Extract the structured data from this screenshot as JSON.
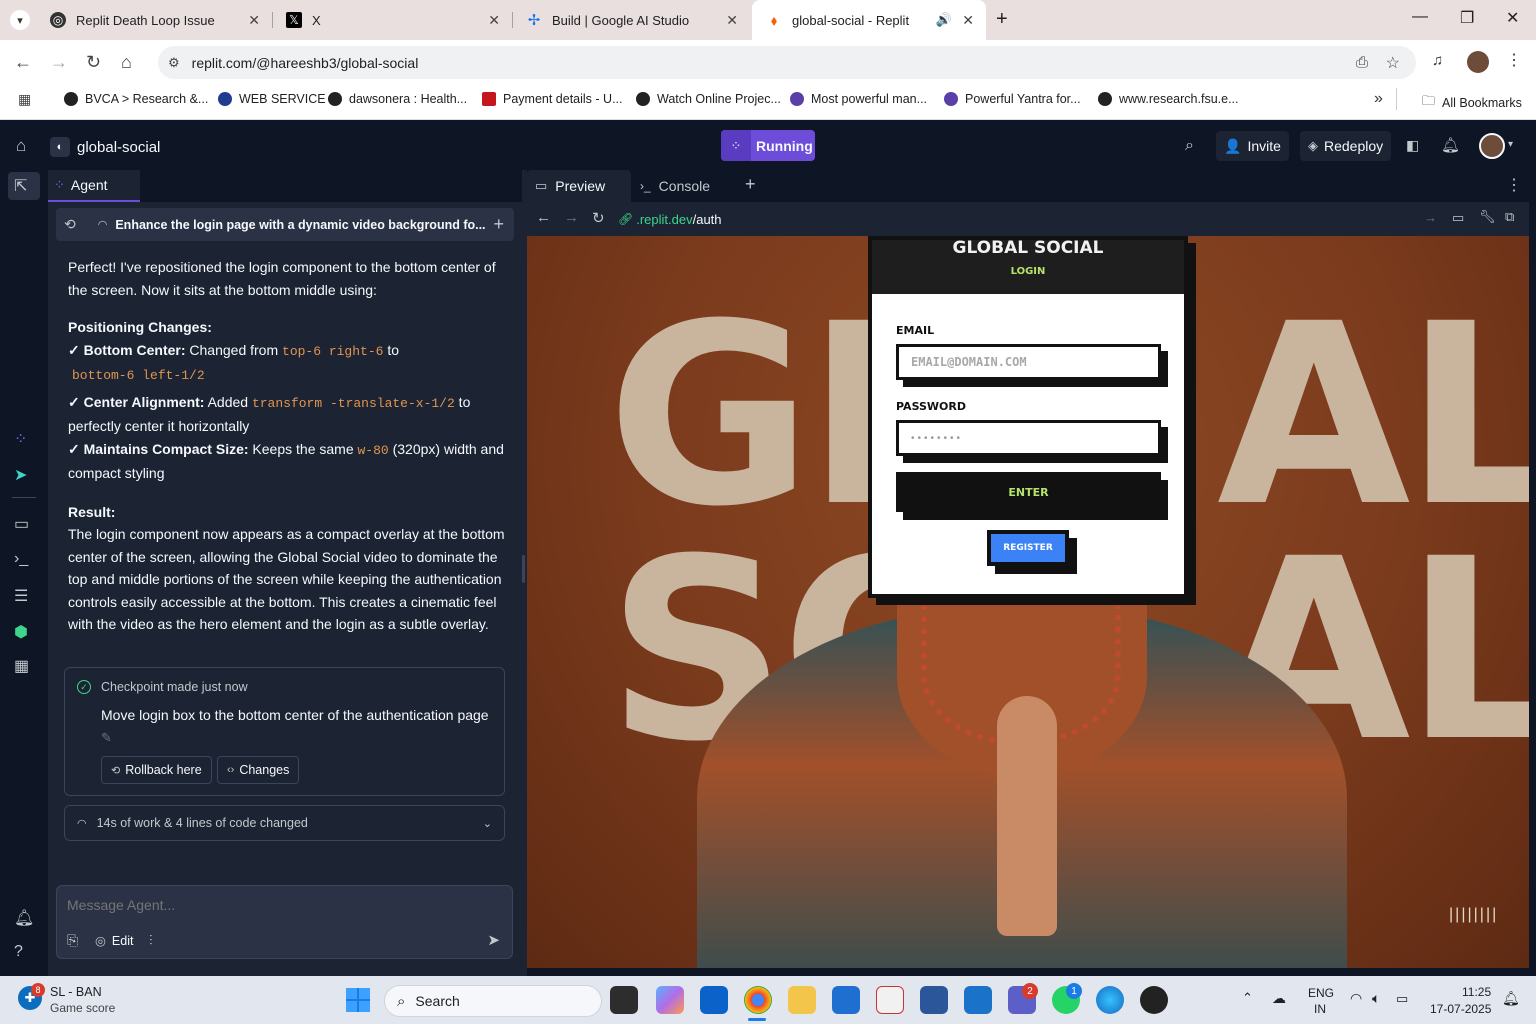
{
  "browser": {
    "tabs": [
      {
        "title": "Replit Death Loop Issue"
      },
      {
        "title": "X"
      },
      {
        "title": "Build | Google AI Studio"
      },
      {
        "title": "global-social - Replit"
      }
    ],
    "url": "replit.com/@hareeshb3/global-social",
    "bookmarks": [
      "BVCA > Research &...",
      "WEB SERVICE",
      "dawsonera : Health...",
      "Payment details - U...",
      "Watch Online Projec...",
      "Most powerful man...",
      "Powerful Yantra for...",
      "www.research.fsu.e..."
    ],
    "all_bookmarks": "All Bookmarks"
  },
  "replit": {
    "project_name": "global-social",
    "run_label": "Running",
    "invite_label": "Invite",
    "redeploy_label": "Redeploy"
  },
  "agent": {
    "tab_label": "Agent",
    "thread_title": "Enhance the login page with a dynamic video background fo...",
    "intro": "Perfect! I've repositioned the login component to the bottom center of the screen. Now it sits at the bottom middle using:",
    "positioning_heading": "Positioning Changes:",
    "item1_bold": "✓ Bottom Center:",
    "item1_text": " Changed from ",
    "item1_code1": "top-6 right-6",
    "item1_to": " to",
    "item1_code2": "bottom-6 left-1/2",
    "item2_bold": "✓ Center Alignment:",
    "item2_text": " Added ",
    "item2_code": "transform -translate-x-1/2",
    "item2_rest": " to perfectly center it horizontally",
    "item3_bold": "✓ Maintains Compact Size:",
    "item3_text": " Keeps the same ",
    "item3_code": "w-80",
    "item3_rest": " (320px) width and compact styling",
    "result_heading": "Result:",
    "result_text": "The login component now appears as a compact overlay at the bottom center of the screen, allowing the Global Social video to dominate the top and middle portions of the screen while keeping the authentication controls easily accessible at the bottom. This creates a cinematic feel with the video as the hero element and the login as a subtle overlay.",
    "checkpoint_status": "Checkpoint made just now",
    "checkpoint_desc": "Move login box to the bottom center of the authentication page",
    "rollback_label": "Rollback here",
    "changes_label": "Changes",
    "work_summary": "14s of work & 4 lines of code changed",
    "input_placeholder": "Message Agent...",
    "edit_label": "Edit"
  },
  "preview": {
    "tab_preview": "Preview",
    "tab_console": "Console",
    "url_host": ".replit.dev",
    "url_path": "/auth",
    "bg_line1": "GL",
    "bg_line1b": "AL",
    "bg_line2": "SO",
    "bg_line2b": "AL",
    "login": {
      "title": "GLOBAL SOCIAL",
      "subtitle": "LOGIN",
      "email_label": "EMAIL",
      "email_placeholder": "EMAIL@DOMAIN.COM",
      "password_label": "PASSWORD",
      "password_mask": "••••••••",
      "enter_label": "ENTER",
      "register_label": "REGISTER"
    }
  },
  "taskbar": {
    "weather_title": "SL - BAN",
    "weather_sub": "Game score",
    "weather_badge": "8",
    "search_label": "Search",
    "lang1": "ENG",
    "lang2": "IN",
    "time": "11:25",
    "date": "17-07-2025",
    "teams_badge": "2",
    "whatsapp_badge": "1"
  },
  "colors": {
    "accent": "#6c4cd8",
    "enter_text": "#b5e36a",
    "register_bg": "#3b82f6",
    "code": "#e09550"
  }
}
